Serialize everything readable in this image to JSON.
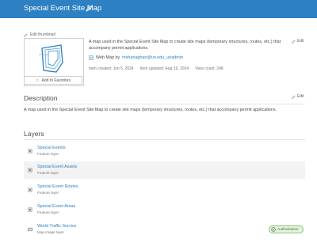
{
  "header": {
    "title": "Special Event Site Map",
    "bg_color": "#2d80c1",
    "edit_icon": "pencil-icon"
  },
  "thumbnail": {
    "edit_label": "Edit thumbnail",
    "favorites_label": "Add to Favorites",
    "favorites_icon": "star-icon"
  },
  "summary": {
    "text": "A map used in the Special Event Site Map to create site maps (temporary structures, routes, etc.) that accompany permit applications.",
    "edit_label": "Edit",
    "item_type": "Web Map by",
    "owner": "mshanaghan@uri.edu_uriadmin",
    "created": "Item created: Jun 5, 2024",
    "updated": "Item updated: Aug 19, 2024",
    "views": "View count: 248"
  },
  "description": {
    "heading": "Description",
    "edit_label": "Edit",
    "text": "A map used in the Special Event Site Map to create site maps (temporary structures, routes, etc.) that accompany permit applications."
  },
  "layers": {
    "heading": "Layers",
    "items": [
      {
        "name": "Special Events",
        "type": "Feature layer",
        "icon": "feature-layer-icon"
      },
      {
        "name": "Special Event Assets",
        "type": "Feature layer",
        "icon": "feature-layer-icon"
      },
      {
        "name": "Special Event Routes",
        "type": "Feature layer",
        "icon": "feature-layer-icon"
      },
      {
        "name": "Special Event Areas",
        "type": "Feature layer",
        "icon": "feature-layer-icon"
      },
      {
        "name": "World Traffic Service",
        "type": "Map image layer",
        "icon": "map-image-layer-icon",
        "badge": "Authoritative"
      }
    ]
  },
  "colors": {
    "link": "#2d80c1",
    "badge_bg": "#e5f3df",
    "badge_border": "#8cc47a"
  }
}
